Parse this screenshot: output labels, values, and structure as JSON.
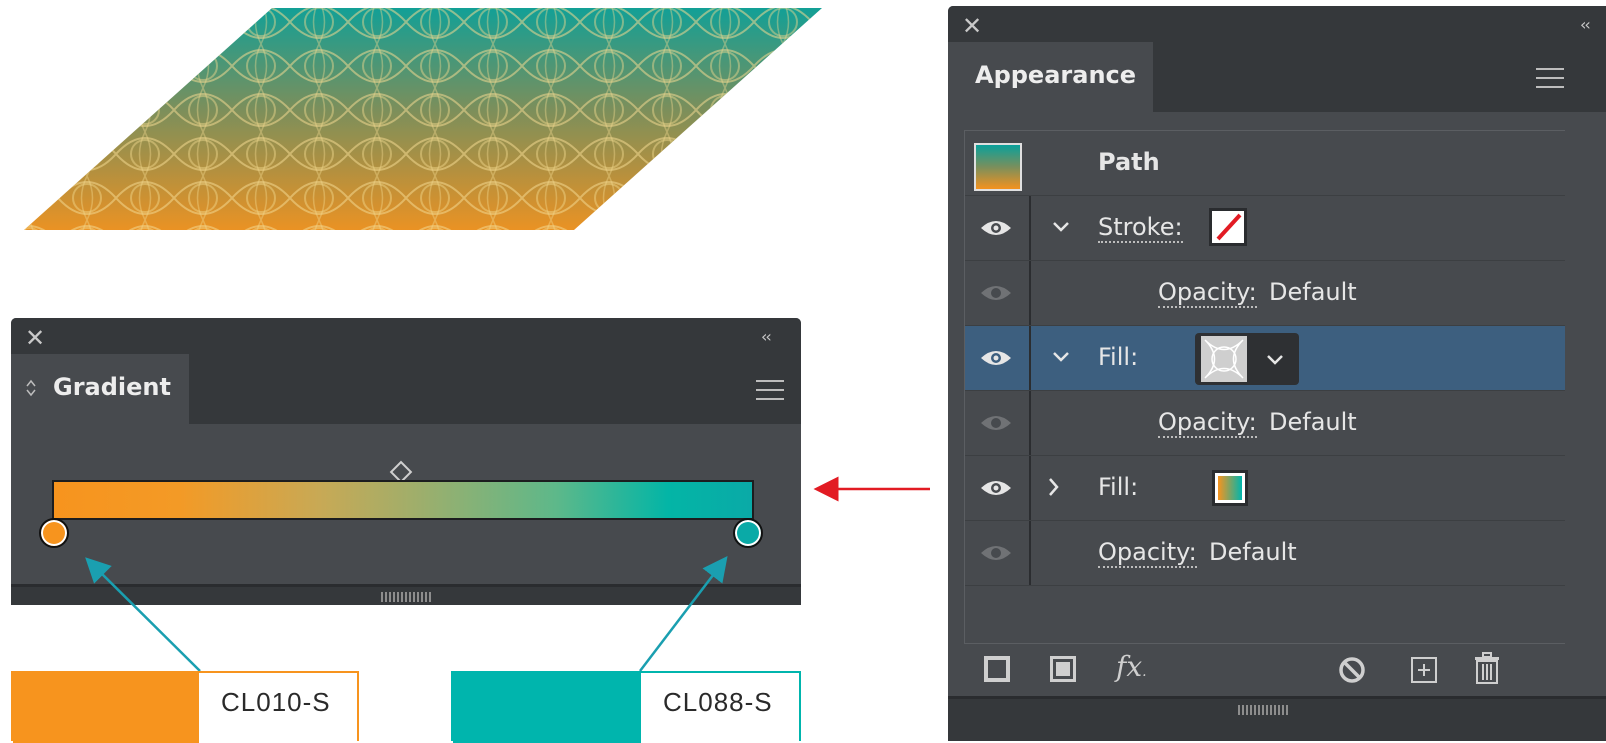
{
  "artwork": {
    "gradient_top": "#0aa19b",
    "gradient_bottom": "#f3921f",
    "pattern_color": "#e9d28a"
  },
  "gradient_panel": {
    "title": "Gradient",
    "stops": [
      {
        "position": 0,
        "color": "#f7941e"
      },
      {
        "position": 1,
        "color": "#0aaaa7"
      }
    ],
    "midpoint": 0.5
  },
  "swatches": [
    {
      "label": "CL010-S",
      "color": "#f7941e"
    },
    {
      "label": "CL088-S",
      "color": "#00b5ad"
    }
  ],
  "appearance_panel": {
    "title": "Appearance",
    "header": "Path",
    "rows": [
      {
        "label": "Stroke:",
        "expanded": true
      },
      {
        "label_link": "Opacity:",
        "value": "Default"
      },
      {
        "label": "Fill:",
        "expanded": true,
        "selected": true
      },
      {
        "label_link": "Opacity:",
        "value": "Default"
      },
      {
        "label": "Fill:",
        "expanded": false
      },
      {
        "label_link": "Opacity:",
        "value": "Default"
      }
    ],
    "footer_icons": [
      "add-stroke-icon",
      "add-fill-icon",
      "fx-icon",
      "clear-appearance-icon",
      "duplicate-item-icon",
      "trash-icon"
    ]
  },
  "colors": {
    "panel_bg": "#474a4e",
    "panel_dark": "#35383b",
    "selected_row": "#3d5f7f",
    "arrow_red": "#e21b23",
    "arrow_teal": "#1a9fb0"
  }
}
